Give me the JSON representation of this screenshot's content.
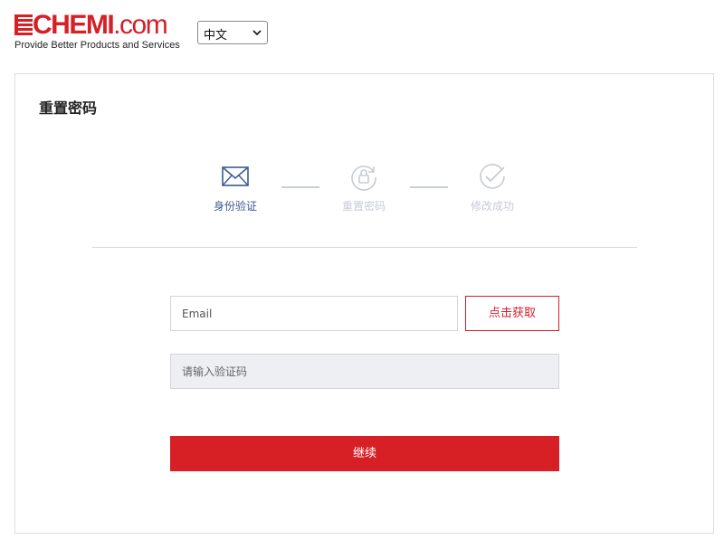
{
  "header": {
    "logo": {
      "brand_prefix": "E",
      "brand_bold": "CHEMI",
      "brand_suffix": ".com",
      "tagline": "Provide Better Products and Services"
    },
    "language_select": {
      "selected": "中文"
    }
  },
  "card": {
    "title": "重置密码",
    "steps": [
      {
        "label": "身份验证",
        "icon": "envelope-icon",
        "state": "active"
      },
      {
        "label": "重置密码",
        "icon": "lock-reset-icon",
        "state": "inactive"
      },
      {
        "label": "修改成功",
        "icon": "check-circle-icon",
        "state": "inactive"
      }
    ],
    "email_field": {
      "placeholder": "Email",
      "value": ""
    },
    "get_code_button": {
      "label": "点击获取"
    },
    "code_field": {
      "placeholder": "请输入验证码",
      "value": ""
    },
    "continue_button": {
      "label": "继续"
    }
  },
  "colors": {
    "brand_red": "#d71f26",
    "active_step": "#3d5a8f",
    "inactive_step": "#c7cbd4",
    "code_field_bg": "#edeff2"
  }
}
